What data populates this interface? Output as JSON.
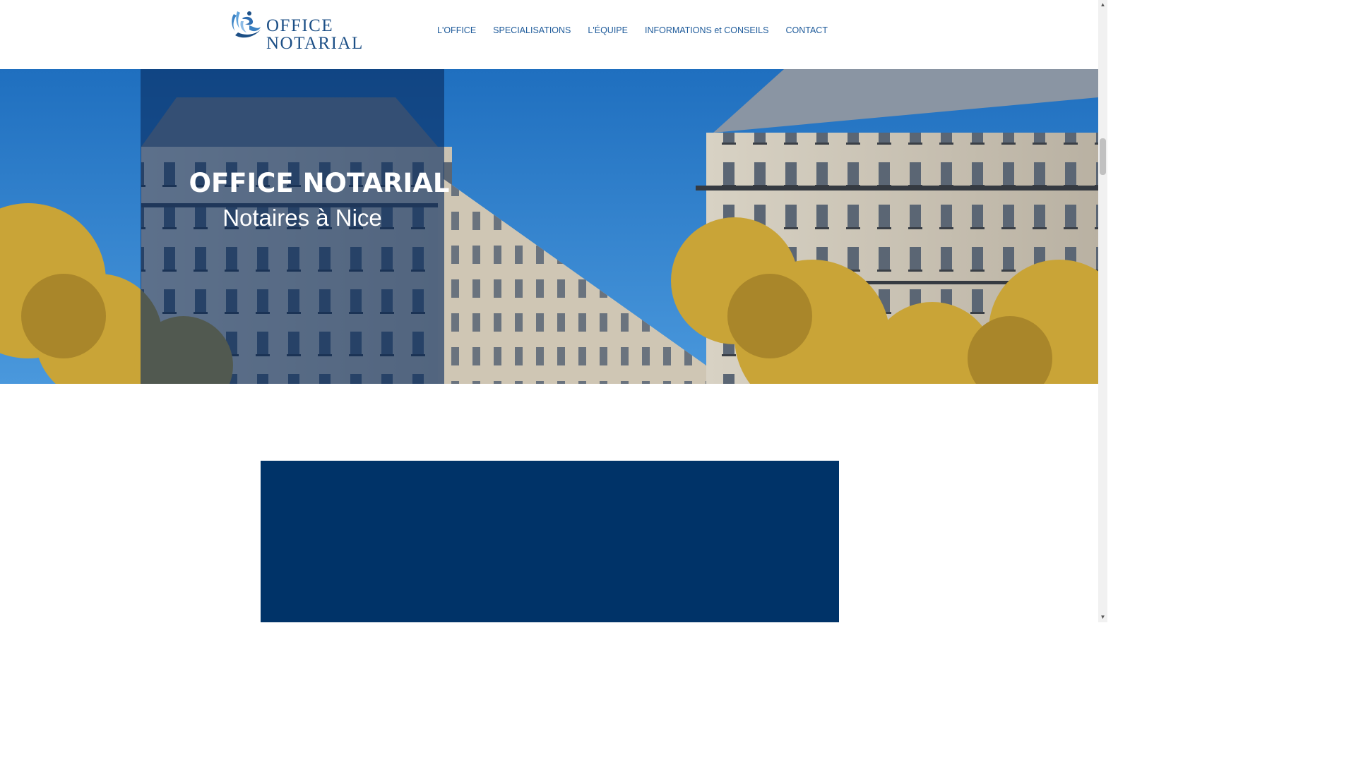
{
  "header": {
    "logo": {
      "icon": "notary-emblem-icon",
      "line1": "OFFICE",
      "line2": "NOTARIAL"
    },
    "nav": [
      {
        "label": "L'OFFICE"
      },
      {
        "label": "SPECIALISATIONS"
      },
      {
        "label": "L'ÉQUIPE"
      },
      {
        "label": "INFORMATIONS et CONSEILS"
      },
      {
        "label": "CONTACT"
      }
    ]
  },
  "hero": {
    "title": "OFFICE NOTARIAL",
    "subtitle": "Notaires à Nice"
  },
  "colors": {
    "brand_blue": "#1c4f86",
    "nav_text": "#1d5a9a",
    "panel_blue": "#003368",
    "overlay_blue": "#082c60"
  },
  "scrollbar": {
    "up_icon": "scroll-up-arrow-icon",
    "down_icon": "scroll-down-arrow-icon"
  }
}
